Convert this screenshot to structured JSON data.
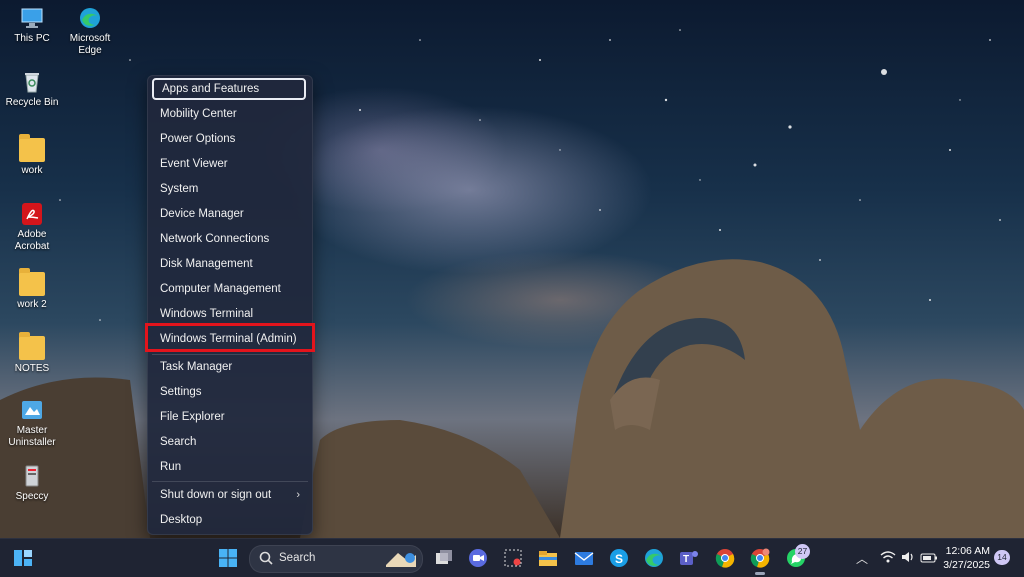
{
  "desktop": {
    "icons": [
      {
        "label": "This PC"
      },
      {
        "label": "Microsoft Edge"
      },
      {
        "label": "Recycle Bin"
      },
      {
        "label": "work"
      },
      {
        "label": "Adobe Acrobat"
      },
      {
        "label": "work 2"
      },
      {
        "label": "NOTES"
      },
      {
        "label": "Master Uninstaller"
      },
      {
        "label": "Speccy"
      }
    ]
  },
  "context_menu": {
    "items": [
      {
        "label": "Apps and Features",
        "focused": true
      },
      {
        "label": "Mobility Center"
      },
      {
        "label": "Power Options"
      },
      {
        "label": "Event Viewer"
      },
      {
        "label": "System"
      },
      {
        "label": "Device Manager"
      },
      {
        "label": "Network Connections"
      },
      {
        "label": "Disk Management"
      },
      {
        "label": "Computer Management"
      },
      {
        "label": "Windows Terminal"
      },
      {
        "label": "Windows Terminal (Admin)",
        "highlighted": true
      },
      {
        "label": "Task Manager"
      },
      {
        "label": "Settings"
      },
      {
        "label": "File Explorer"
      },
      {
        "label": "Search"
      },
      {
        "label": "Run"
      },
      {
        "label": "Shut down or sign out",
        "has_submenu": true
      },
      {
        "label": "Desktop"
      }
    ],
    "highlight_color": "#e3141c"
  },
  "taskbar": {
    "search_label": "Search",
    "apps": [
      "start-icon",
      "task-view-icon",
      "zoom-icon",
      "snipping-tool-icon",
      "file-explorer-icon",
      "mail-icon",
      "skype-icon",
      "edge-icon",
      "teams-icon",
      "chrome-icon",
      "chrome-profile-icon",
      "whatsapp-icon"
    ],
    "whatsapp_badge": "27",
    "clock_time": "12:06 AM",
    "clock_date": "3/27/2025",
    "notification_count": "14"
  }
}
